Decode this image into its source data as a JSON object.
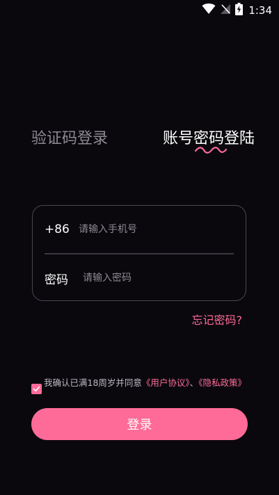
{
  "status_bar": {
    "time": "1:34",
    "icons": [
      "wifi-icon",
      "no-signal-icon",
      "battery-charging-icon"
    ]
  },
  "tabs": {
    "sms_login": "验证码登录",
    "password_login": "账号密码登陆"
  },
  "form": {
    "phone_prefix": "+86",
    "phone_placeholder": "请输入手机号",
    "password_label": "密码",
    "password_placeholder": "请输入密码"
  },
  "forgot_password": "忘记密码?",
  "agreement": {
    "checked": true,
    "prefix": "我确认已满18周岁并同意",
    "user_agreement": "《用户协议》",
    "separator": "、",
    "privacy_policy": "《隐私政策》"
  },
  "login_button": "登录",
  "colors": {
    "background": "#0a080d",
    "accent": "#ff6b99",
    "muted_text": "#8d8a92",
    "border": "#4a4850"
  }
}
